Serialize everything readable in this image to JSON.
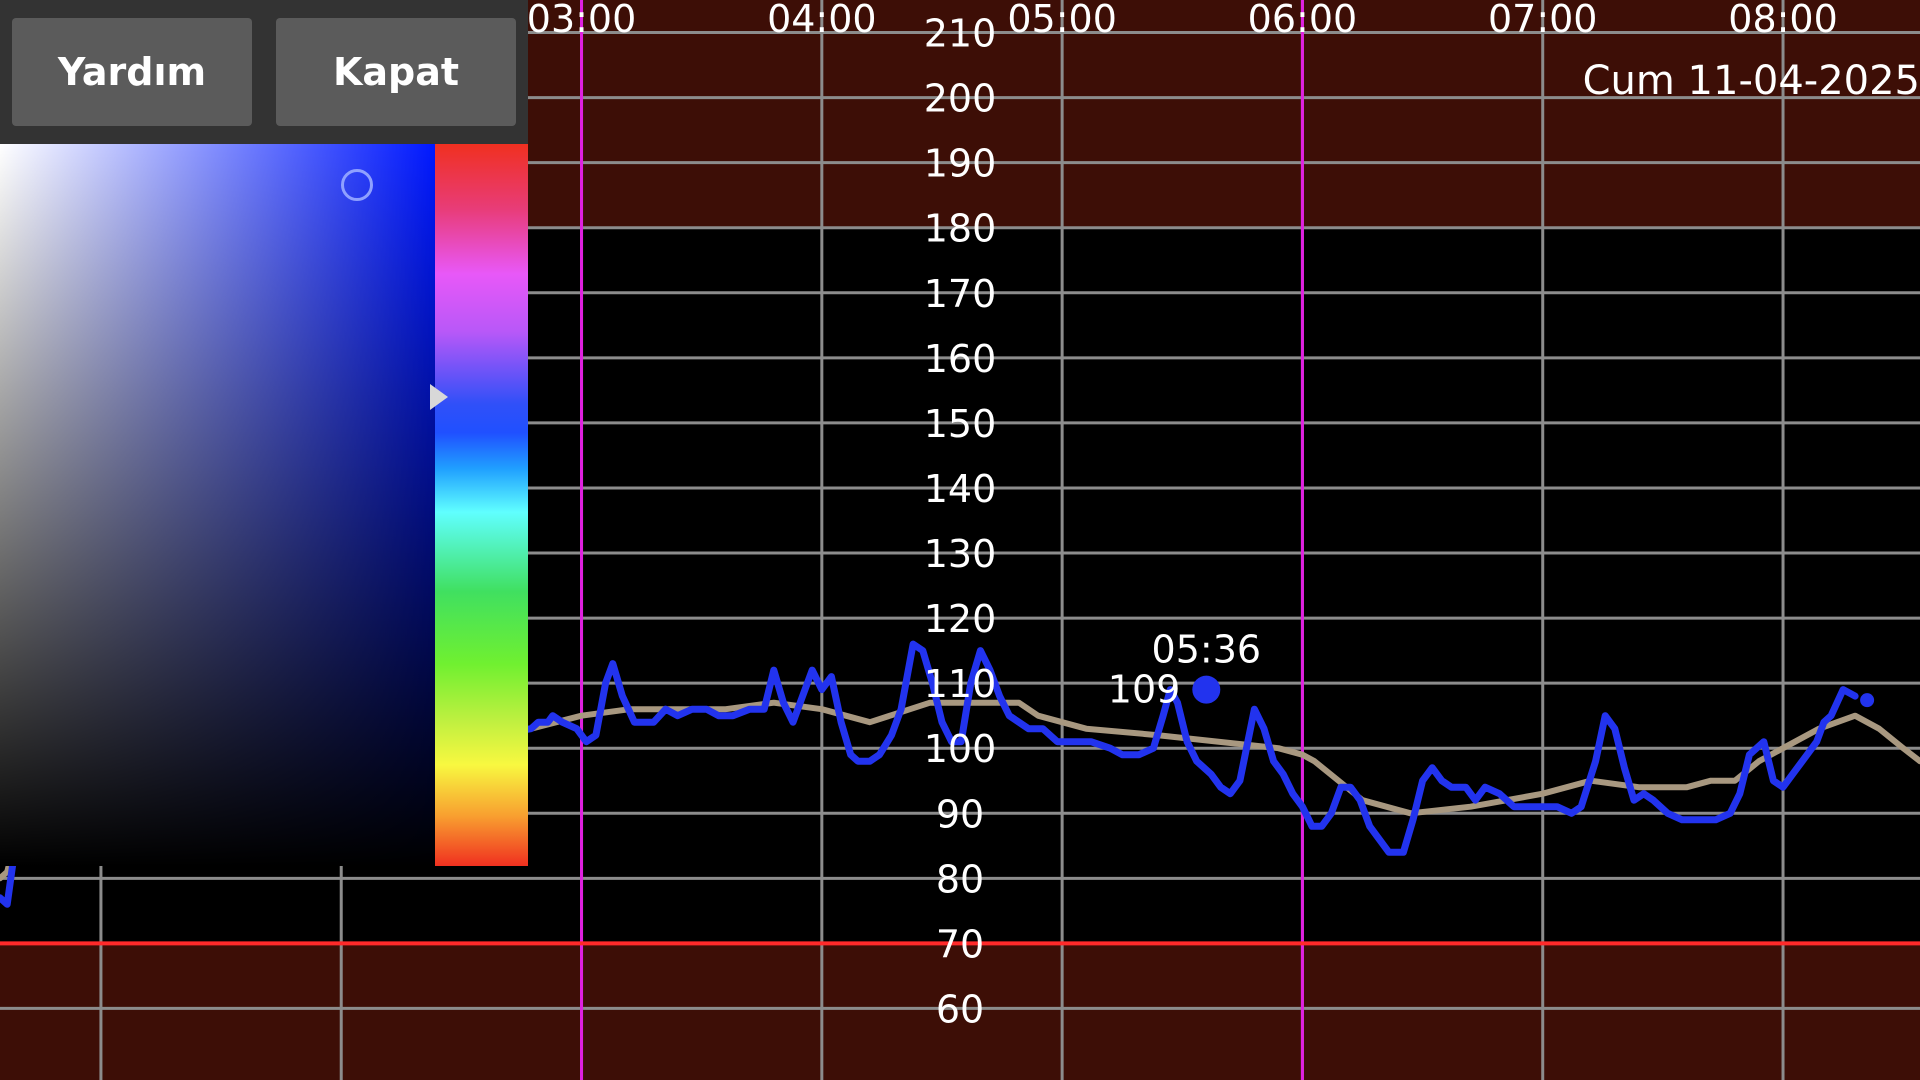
{
  "picker": {
    "help_label": "Yardım",
    "close_label": "Kapat",
    "hue_handle_fraction": 0.35,
    "sv_handle_saturation": 0.82,
    "sv_handle_value": 0.96
  },
  "date_label": "Cum 11-04-2025",
  "colors": {
    "background": "#000000",
    "high_zone": "#3d0e06",
    "grid": "#8c8c8c",
    "midnight_lines": "#e020e0",
    "low_limit": "#ff2a2a",
    "glucose_line": "#2233ee",
    "trend_line": "#a89880",
    "marker_text": "#2233ee"
  },
  "marker": {
    "time": "05:36",
    "value": "109"
  },
  "chart_data": {
    "type": "line",
    "x_unit": "hour",
    "xlim": [
      0.58,
      8.57
    ],
    "ylim": [
      49,
      215
    ],
    "x_ticks": [
      {
        "t": 1,
        "label": ""
      },
      {
        "t": 2,
        "label": ""
      },
      {
        "t": 3,
        "label": "03:00"
      },
      {
        "t": 4,
        "label": "04:00"
      },
      {
        "t": 5,
        "label": "05:00"
      },
      {
        "t": 6,
        "label": "06:00"
      },
      {
        "t": 7,
        "label": "07:00"
      },
      {
        "t": 8,
        "label": "08:00"
      }
    ],
    "y_ticks": [
      60,
      70,
      80,
      90,
      100,
      110,
      120,
      130,
      140,
      150,
      160,
      170,
      180,
      190,
      200,
      210
    ],
    "y_tick_labels": [
      "60",
      "70",
      "80",
      "90",
      "100",
      "110",
      "120",
      "130",
      "140",
      "150",
      "160",
      "170",
      "180",
      "190",
      "200",
      "210"
    ],
    "high_threshold": 180,
    "low_threshold": 70,
    "midnight_lines": [
      3.0,
      6.0
    ],
    "series": [
      {
        "values": [
          [
            0.58,
            77
          ],
          [
            0.61,
            76
          ],
          [
            0.64,
            84
          ],
          [
            0.67,
            87
          ],
          [
            0.7,
            90
          ],
          [
            2.79,
            103
          ],
          [
            2.82,
            104
          ],
          [
            2.86,
            104
          ],
          [
            2.88,
            105
          ],
          [
            2.92,
            104
          ],
          [
            2.98,
            103
          ],
          [
            3.02,
            101
          ],
          [
            3.06,
            102
          ],
          [
            3.1,
            110
          ],
          [
            3.13,
            113
          ],
          [
            3.17,
            108
          ],
          [
            3.22,
            104
          ],
          [
            3.3,
            104
          ],
          [
            3.35,
            106
          ],
          [
            3.4,
            105
          ],
          [
            3.46,
            106
          ],
          [
            3.52,
            106
          ],
          [
            3.57,
            105
          ],
          [
            3.63,
            105
          ],
          [
            3.7,
            106
          ],
          [
            3.76,
            106
          ],
          [
            3.8,
            112
          ],
          [
            3.84,
            107
          ],
          [
            3.88,
            104
          ],
          [
            3.92,
            108
          ],
          [
            3.96,
            112
          ],
          [
            4.0,
            109
          ],
          [
            4.04,
            111
          ],
          [
            4.08,
            104
          ],
          [
            4.12,
            99
          ],
          [
            4.15,
            98
          ],
          [
            4.2,
            98
          ],
          [
            4.24,
            99
          ],
          [
            4.29,
            102
          ],
          [
            4.33,
            106
          ],
          [
            4.38,
            116
          ],
          [
            4.42,
            115
          ],
          [
            4.46,
            110
          ],
          [
            4.5,
            104
          ],
          [
            4.54,
            101
          ],
          [
            4.58,
            101
          ],
          [
            4.62,
            110
          ],
          [
            4.66,
            115
          ],
          [
            4.7,
            112
          ],
          [
            4.74,
            108
          ],
          [
            4.78,
            105
          ],
          [
            4.82,
            104
          ],
          [
            4.86,
            103
          ],
          [
            4.92,
            103
          ],
          [
            4.98,
            101
          ],
          [
            5.04,
            101
          ],
          [
            5.12,
            101
          ],
          [
            5.2,
            100
          ],
          [
            5.25,
            99
          ],
          [
            5.32,
            99
          ],
          [
            5.38,
            100
          ],
          [
            5.42,
            105
          ],
          [
            5.45,
            109
          ],
          [
            5.48,
            107
          ],
          [
            5.52,
            101
          ],
          [
            5.56,
            98
          ],
          [
            5.62,
            96
          ],
          [
            5.66,
            94
          ],
          [
            5.7,
            93
          ],
          [
            5.74,
            95
          ],
          [
            5.8,
            106
          ],
          [
            5.84,
            103
          ],
          [
            5.88,
            98
          ],
          [
            5.92,
            96
          ],
          [
            5.96,
            93
          ],
          [
            6.0,
            91
          ],
          [
            6.04,
            88
          ],
          [
            6.08,
            88
          ],
          [
            6.12,
            90
          ],
          [
            6.16,
            94
          ],
          [
            6.2,
            94
          ],
          [
            6.24,
            92
          ],
          [
            6.28,
            88
          ],
          [
            6.32,
            86
          ],
          [
            6.36,
            84
          ],
          [
            6.42,
            84
          ],
          [
            6.46,
            89
          ],
          [
            6.5,
            95
          ],
          [
            6.54,
            97
          ],
          [
            6.58,
            95
          ],
          [
            6.62,
            94
          ],
          [
            6.68,
            94
          ],
          [
            6.72,
            92
          ],
          [
            6.76,
            94
          ],
          [
            6.82,
            93
          ],
          [
            6.88,
            91
          ],
          [
            6.94,
            91
          ],
          [
            7.0,
            91
          ],
          [
            7.06,
            91
          ],
          [
            7.12,
            90
          ],
          [
            7.16,
            91
          ],
          [
            7.22,
            98
          ],
          [
            7.26,
            105
          ],
          [
            7.3,
            103
          ],
          [
            7.34,
            97
          ],
          [
            7.38,
            92
          ],
          [
            7.42,
            93
          ],
          [
            7.46,
            92
          ],
          [
            7.52,
            90
          ],
          [
            7.58,
            89
          ],
          [
            7.62,
            89
          ],
          [
            7.66,
            89
          ],
          [
            7.72,
            89
          ],
          [
            7.78,
            90
          ],
          [
            7.82,
            93
          ],
          [
            7.86,
            99
          ],
          [
            7.92,
            101
          ],
          [
            7.96,
            95
          ],
          [
            8.0,
            94
          ],
          [
            8.04,
            96
          ],
          [
            8.1,
            99
          ],
          [
            8.14,
            101
          ],
          [
            8.17,
            104
          ],
          [
            8.2,
            105
          ],
          [
            8.25,
            109
          ],
          [
            8.3,
            108
          ]
        ]
      },
      {
        "values": [
          [
            0.58,
            80
          ],
          [
            0.61,
            81
          ],
          [
            0.63,
            84
          ],
          [
            2.79,
            103
          ],
          [
            3.0,
            105
          ],
          [
            3.2,
            106
          ],
          [
            3.4,
            106
          ],
          [
            3.6,
            106
          ],
          [
            3.8,
            107
          ],
          [
            4.0,
            106
          ],
          [
            4.2,
            104
          ],
          [
            4.45,
            107
          ],
          [
            4.62,
            107
          ],
          [
            4.76,
            107
          ],
          [
            4.82,
            107
          ],
          [
            4.9,
            105
          ],
          [
            5.1,
            103
          ],
          [
            5.4,
            102
          ],
          [
            5.9,
            100
          ],
          [
            6.0,
            99
          ],
          [
            6.05,
            98
          ],
          [
            6.15,
            95
          ],
          [
            6.25,
            92
          ],
          [
            6.45,
            90
          ],
          [
            6.7,
            91
          ],
          [
            7.0,
            93
          ],
          [
            7.2,
            95
          ],
          [
            7.4,
            94
          ],
          [
            7.6,
            94
          ],
          [
            7.7,
            95
          ],
          [
            7.8,
            95
          ],
          [
            7.9,
            98
          ],
          [
            8.0,
            100
          ],
          [
            8.15,
            103
          ],
          [
            8.3,
            105
          ],
          [
            8.4,
            103
          ],
          [
            8.5,
            100
          ],
          [
            8.57,
            98
          ]
        ]
      }
    ]
  }
}
